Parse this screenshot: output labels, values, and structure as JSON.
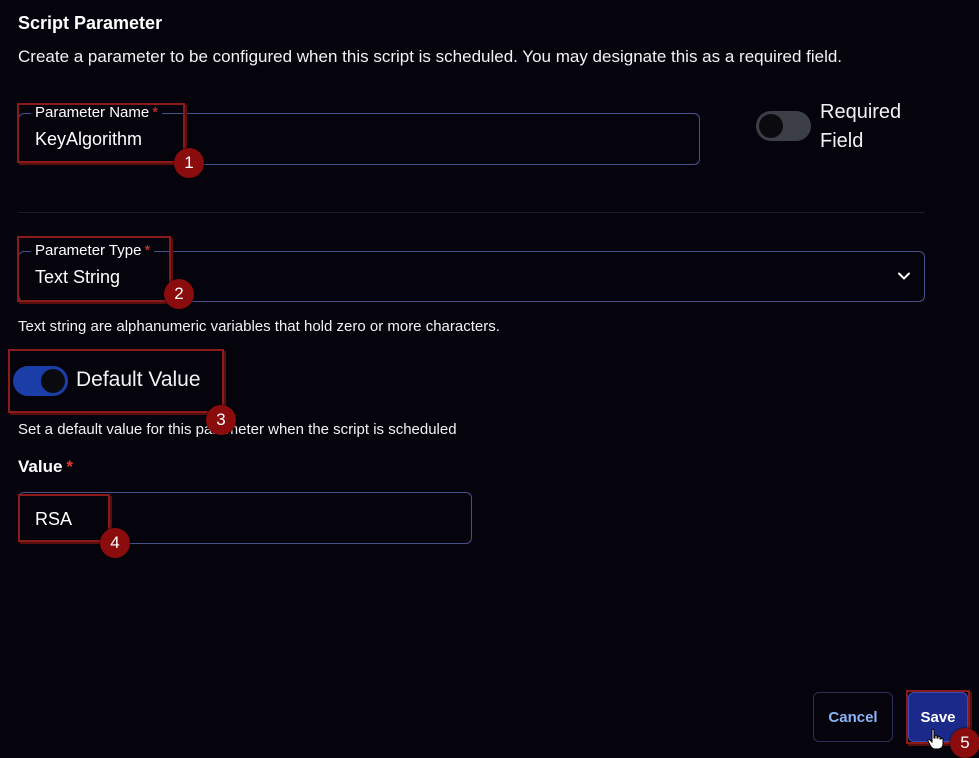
{
  "header": {
    "title": "Script Parameter",
    "description": "Create a parameter to be configured when this script is scheduled. You may designate this as a required field."
  },
  "parameter_name": {
    "label": "Parameter Name",
    "required_mark": "*",
    "value": "KeyAlgorithm"
  },
  "required_field": {
    "label": "Required Field",
    "enabled": false
  },
  "parameter_type": {
    "label": "Parameter Type",
    "required_mark": "*",
    "value": "Text String",
    "help": "Text string are alphanumeric variables that hold zero or more characters."
  },
  "default_value": {
    "label": "Default Value",
    "enabled": true,
    "help": "Set a default value for this parameter when the script is scheduled"
  },
  "value_field": {
    "label": "Value",
    "required_mark": "*",
    "value": "RSA"
  },
  "actions": {
    "cancel_label": "Cancel",
    "save_label": "Save"
  },
  "annotations": [
    "1",
    "2",
    "3",
    "4",
    "5"
  ],
  "colors": {
    "background": "#05040d",
    "accent": "#1b3ea8",
    "required": "#e53935",
    "annotation": "#8b0c0c"
  }
}
